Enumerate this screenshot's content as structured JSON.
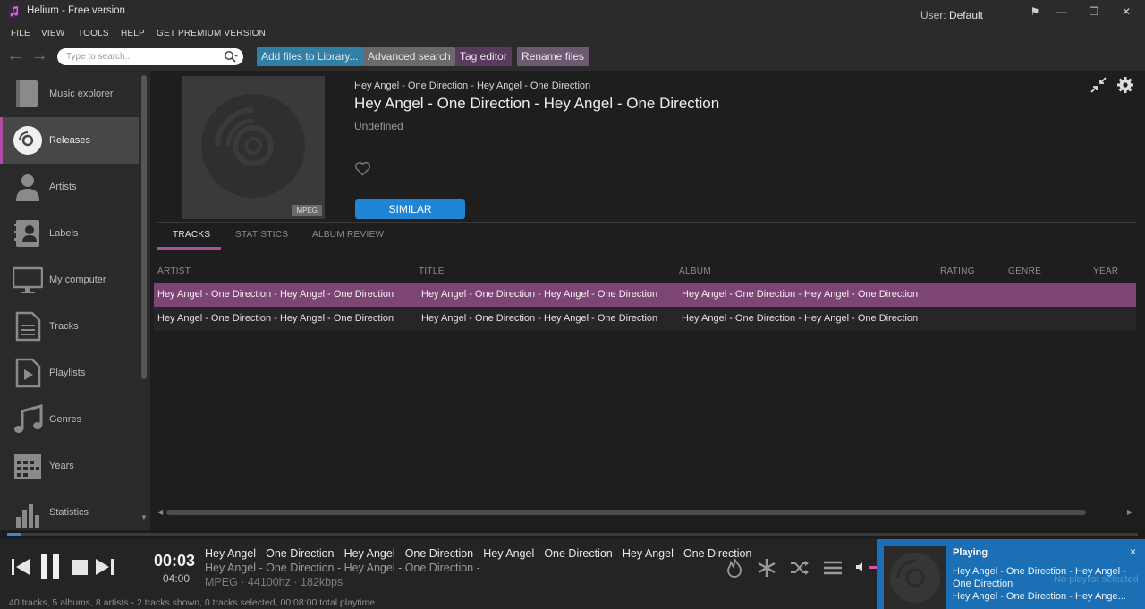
{
  "window": {
    "title": "Helium - Free version",
    "user_prefix": "User:",
    "user_name": "Default",
    "controls": {
      "flag": "⚑",
      "minimize": "—",
      "maximize": "❐",
      "close": "✕"
    }
  },
  "menu": [
    "FILE",
    "VIEW",
    "TOOLS",
    "HELP",
    "GET PREMIUM VERSION"
  ],
  "toolbar": {
    "back": "←",
    "forward": "→",
    "search_placeholder": "Type to search...",
    "buttons": [
      {
        "label": "Add files to Library...",
        "color": "#2f7fa6"
      },
      {
        "label": "Advanced search",
        "color": "#6a6a6a"
      },
      {
        "label": "Tag editor",
        "color": "#5a3a5e"
      },
      {
        "label": "Rename files",
        "color": "#6d5a72"
      }
    ]
  },
  "sidebar": {
    "items": [
      {
        "label": "Music explorer",
        "icon": "book-icon"
      },
      {
        "label": "Releases",
        "icon": "disc-icon",
        "active": true
      },
      {
        "label": "Artists",
        "icon": "person-icon"
      },
      {
        "label": "Labels",
        "icon": "contact-card-icon"
      },
      {
        "label": "My computer",
        "icon": "monitor-icon"
      },
      {
        "label": "Tracks",
        "icon": "document-icon"
      },
      {
        "label": "Playlists",
        "icon": "playlist-icon"
      },
      {
        "label": "Genres",
        "icon": "music-note-icon"
      },
      {
        "label": "Years",
        "icon": "calendar-icon"
      },
      {
        "label": "Statistics",
        "icon": "bar-chart-icon"
      }
    ]
  },
  "release": {
    "small_title": "Hey Angel - One Direction - Hey Angel - One Direction",
    "title": "Hey Angel - One Direction - Hey Angel - One Direction",
    "genre": "Undefined",
    "format_badge": "MPEG",
    "similar_label": "SIMILAR"
  },
  "tabs": [
    {
      "label": "TRACKS",
      "active": true
    },
    {
      "label": "STATISTICS"
    },
    {
      "label": "ALBUM REVIEW"
    }
  ],
  "table": {
    "columns": [
      "ARTIST",
      "TITLE",
      "ALBUM",
      "RATING",
      "GENRE",
      "YEAR"
    ],
    "rows": [
      {
        "artist": "Hey Angel - One Direction - Hey Angel - One Direction",
        "title": "Hey Angel - One Direction - Hey Angel - One Direction",
        "album": "Hey Angel - One Direction - Hey Angel - One Direction",
        "rating": "",
        "genre": "",
        "year": "",
        "selected": true
      },
      {
        "artist": "Hey Angel - One Direction - Hey Angel - One Direction",
        "title": "Hey Angel - One Direction - Hey Angel - One Direction",
        "album": "Hey Angel - One Direction - Hey Angel - One Direction",
        "rating": "",
        "genre": "",
        "year": ""
      }
    ]
  },
  "player": {
    "elapsed": "00:03",
    "total": "04:00",
    "progress": 0.0125,
    "line1": "Hey Angel - One Direction - Hey Angel - One Direction - Hey Angel - One Direction - Hey Angel - One Direction",
    "line2": "Hey Angel - One Direction - Hey Angel - One Direction -",
    "line3": "MPEG · 44100hz · 182kbps"
  },
  "status": "40 tracks, 5 albums, 8 artists - 2 tracks shown, 0 tracks selected, 00:08:00 total playtime",
  "notification": {
    "title": "Playing",
    "close": "×",
    "line1": "Hey Angel - One Direction - Hey Angel - One Direction",
    "line2": "Hey Angel - One Direction - Hey Ange...",
    "ghost": "No playlist selected"
  },
  "colors": {
    "accent": "#b04ca5",
    "selected_row": "#7d4574",
    "similar": "#1f86d6",
    "notification": "#1a6fb5"
  }
}
